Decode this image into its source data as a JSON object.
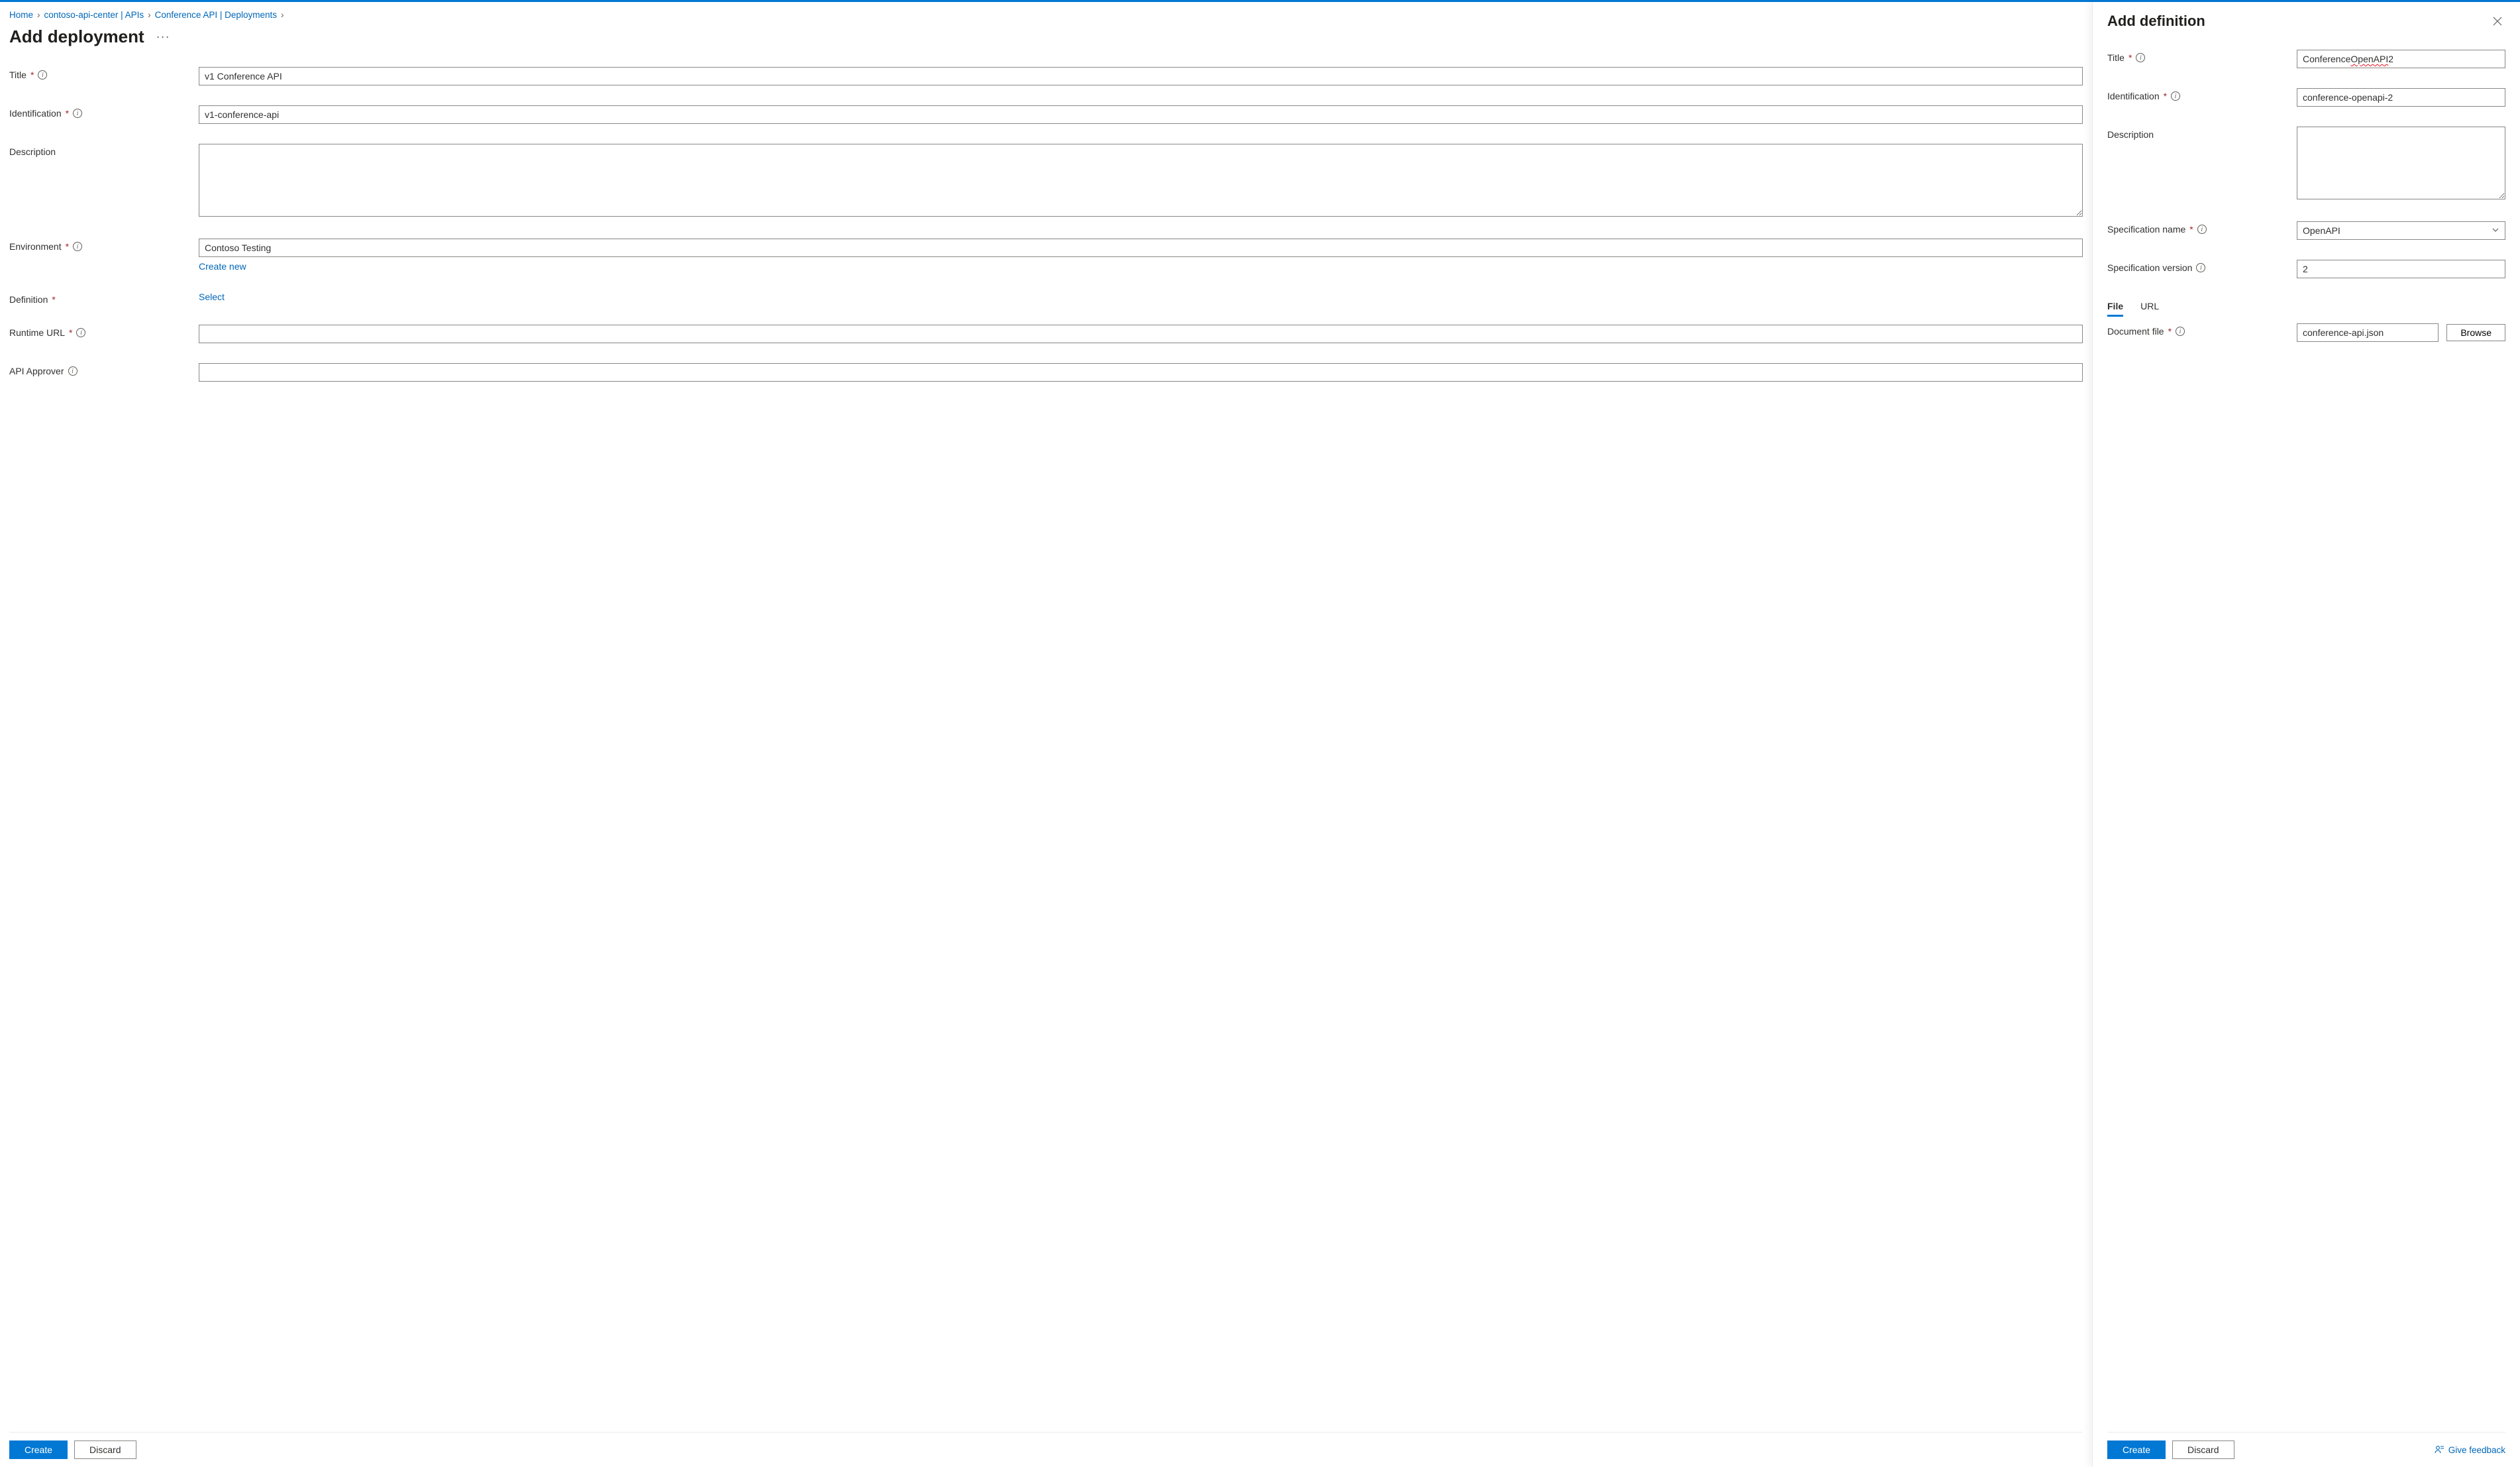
{
  "breadcrumb": {
    "items": [
      {
        "label": "Home"
      },
      {
        "label": "contoso-api-center | APIs"
      },
      {
        "label": "Conference API | Deployments"
      }
    ],
    "separator": "›"
  },
  "main": {
    "title": "Add deployment",
    "more_label": "···",
    "fields": {
      "title": {
        "label": "Title",
        "value": "v1 Conference API"
      },
      "identification": {
        "label": "Identification",
        "value": "v1-conference-api"
      },
      "description": {
        "label": "Description",
        "value": ""
      },
      "environment": {
        "label": "Environment",
        "value": "Contoso Testing",
        "create_new_label": "Create new"
      },
      "definition": {
        "label": "Definition",
        "select_label": "Select"
      },
      "runtime_url": {
        "label": "Runtime URL",
        "value": ""
      },
      "api_approver": {
        "label": "API Approver",
        "value": ""
      }
    },
    "footer": {
      "create": "Create",
      "discard": "Discard"
    }
  },
  "side": {
    "title": "Add definition",
    "fields": {
      "title": {
        "label": "Title",
        "value_prefix": "Conference ",
        "value_spell": "OpenAPI",
        "value_suffix": " 2"
      },
      "identification": {
        "label": "Identification",
        "value": "conference-openapi-2"
      },
      "description": {
        "label": "Description",
        "value": ""
      },
      "spec_name": {
        "label": "Specification name",
        "value": "OpenAPI"
      },
      "spec_version": {
        "label": "Specification version",
        "value": "2"
      },
      "tabs": {
        "file": "File",
        "url": "URL"
      },
      "doc_file": {
        "label": "Document file",
        "value": "conference-api.json",
        "browse": "Browse"
      }
    },
    "footer": {
      "create": "Create",
      "discard": "Discard",
      "feedback": "Give feedback"
    }
  }
}
